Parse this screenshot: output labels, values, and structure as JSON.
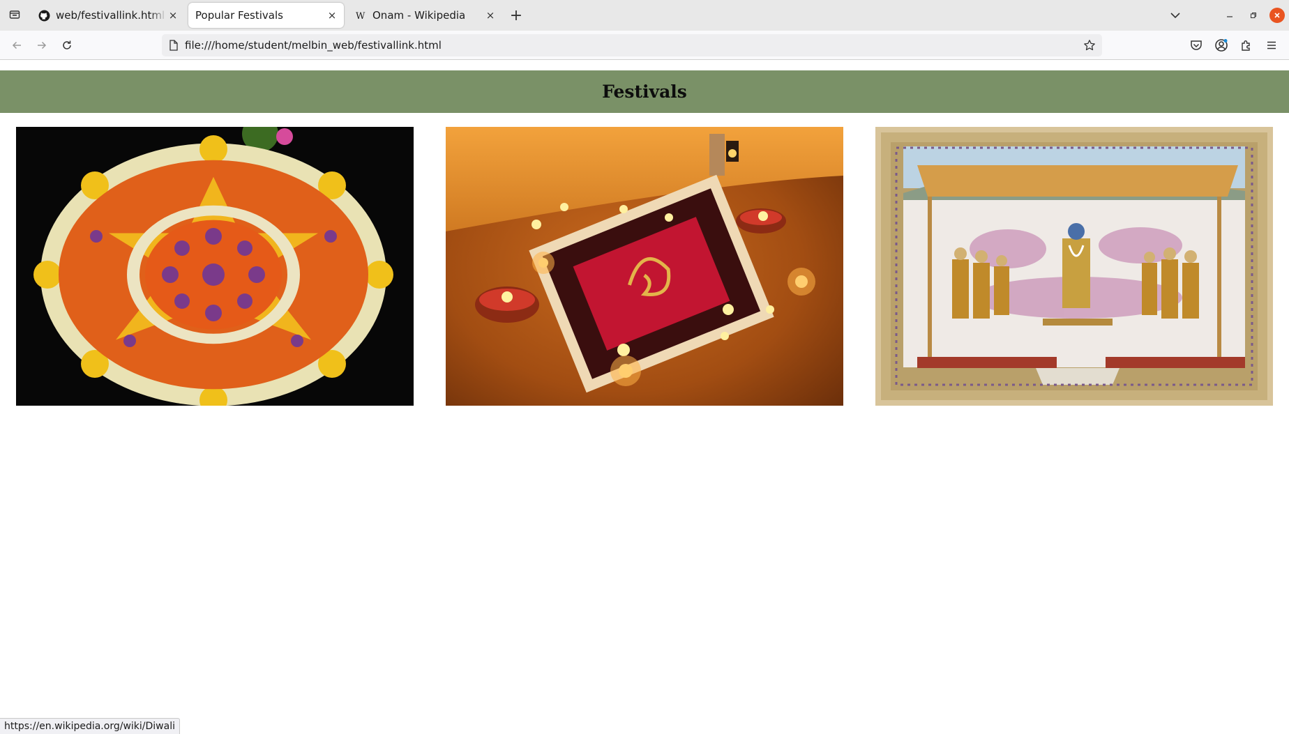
{
  "tabs": [
    {
      "title": "web/festivallink.html at main",
      "icon": "github-icon",
      "active": false
    },
    {
      "title": "Popular Festivals",
      "icon": "none",
      "active": true
    },
    {
      "title": "Onam - Wikipedia",
      "icon": "wikipedia-icon",
      "active": false
    }
  ],
  "toolbar": {
    "url": "file:///home/student/melbin_web/festivallink.html",
    "close_glyph": "×",
    "new_tab_glyph": "+"
  },
  "page": {
    "heading": "Festivals",
    "header_color": "#7a9167",
    "images": [
      {
        "name": "onam-pookalam-image",
        "subject": "flower carpet (pookalam)"
      },
      {
        "name": "diwali-diya-rangoli-image",
        "subject": "diyas and rangoli"
      },
      {
        "name": "holi-painting-image",
        "subject": "miniature painting"
      }
    ]
  },
  "status": {
    "link_preview": "https://en.wikipedia.org/wiki/Diwali"
  },
  "colors": {
    "tabstrip": "#e8e8e8",
    "navbar": "#f9f9fb",
    "window_close": "#e95420"
  }
}
